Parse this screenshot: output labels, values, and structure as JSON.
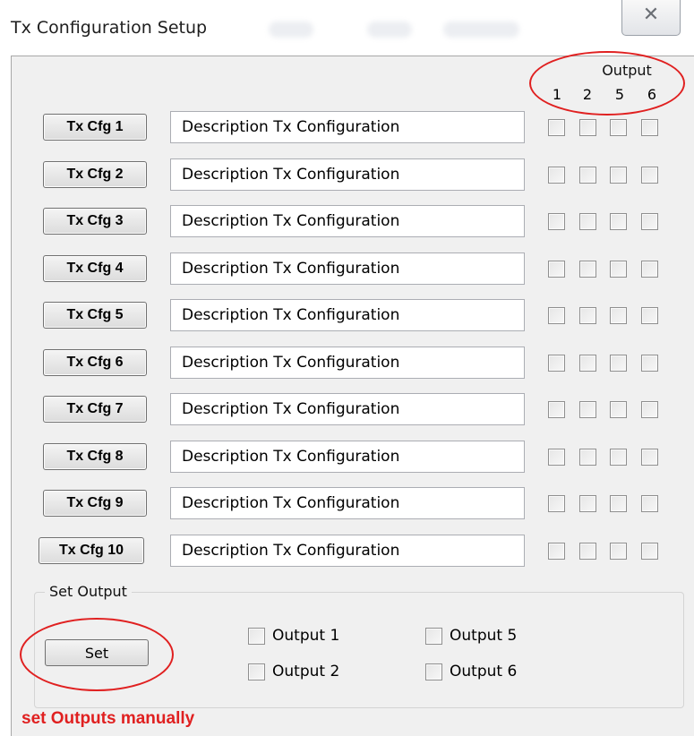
{
  "window": {
    "title": "Tx Configuration Setup",
    "close_symbol": "✕",
    "close_icon": "close-icon"
  },
  "outputs_header": {
    "label": "Output",
    "columns": [
      "1",
      "2",
      "5",
      "6"
    ]
  },
  "rows": [
    {
      "button": "Tx Cfg 1",
      "description": "Description Tx Configuration",
      "checked": [
        false,
        false,
        false,
        false
      ]
    },
    {
      "button": "Tx Cfg 2",
      "description": "Description Tx Configuration",
      "checked": [
        false,
        false,
        false,
        false
      ]
    },
    {
      "button": "Tx Cfg 3",
      "description": "Description Tx Configuration",
      "checked": [
        false,
        false,
        false,
        false
      ]
    },
    {
      "button": "Tx Cfg 4",
      "description": "Description Tx Configuration",
      "checked": [
        false,
        false,
        false,
        false
      ]
    },
    {
      "button": "Tx Cfg 5",
      "description": "Description Tx Configuration",
      "checked": [
        false,
        false,
        false,
        false
      ]
    },
    {
      "button": "Tx Cfg 6",
      "description": "Description Tx Configuration",
      "checked": [
        false,
        false,
        false,
        false
      ]
    },
    {
      "button": "Tx Cfg 7",
      "description": "Description Tx Configuration",
      "checked": [
        false,
        false,
        false,
        false
      ]
    },
    {
      "button": "Tx Cfg 8",
      "description": "Description Tx Configuration",
      "checked": [
        false,
        false,
        false,
        false
      ]
    },
    {
      "button": "Tx Cfg 9",
      "description": "Description Tx Configuration",
      "checked": [
        false,
        false,
        false,
        false
      ]
    },
    {
      "button": "Tx Cfg 10",
      "description": "Description Tx Configuration",
      "checked": [
        false,
        false,
        false,
        false
      ]
    }
  ],
  "set_output": {
    "group_label": "Set Output",
    "button": "Set",
    "options": [
      {
        "label": "Output 1",
        "checked": false
      },
      {
        "label": "Output 2",
        "checked": false
      },
      {
        "label": "Output 5",
        "checked": false
      },
      {
        "label": "Output 6",
        "checked": false
      }
    ]
  },
  "annotation": {
    "text": "set Outputs manually",
    "color": "#e02020"
  }
}
